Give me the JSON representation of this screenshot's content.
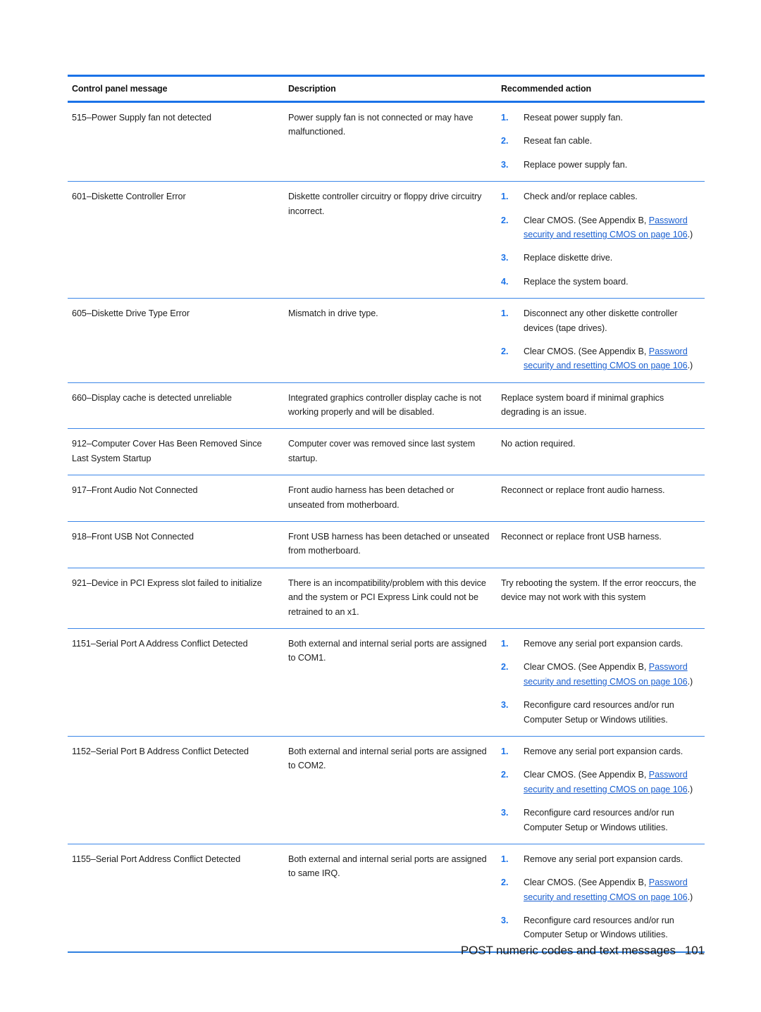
{
  "colors": {
    "rule_blue": "#1a72e8",
    "row_rule_blue": "#3b86e8",
    "link_blue": "#1a5fd0",
    "text": "#1c1c1c"
  },
  "table": {
    "headers": {
      "col1": "Control panel message",
      "col2": "Description",
      "col3": "Recommended action"
    },
    "rows": [
      {
        "message": "515–Power Supply fan not detected",
        "description": "Power supply fan is not connected or may have malfunctioned.",
        "action_type": "steps",
        "steps": [
          {
            "num": "1.",
            "text": "Reseat power supply fan."
          },
          {
            "num": "2.",
            "text": "Reseat fan cable."
          },
          {
            "num": "3.",
            "text": "Replace power supply fan."
          }
        ]
      },
      {
        "message": "601–Diskette Controller Error",
        "description": "Diskette controller circuitry or floppy drive circuitry incorrect.",
        "action_type": "steps",
        "steps": [
          {
            "num": "1.",
            "text": "Check and/or replace cables."
          },
          {
            "num": "2.",
            "text": "Clear CMOS. (See Appendix B, ",
            "link": "Password security and resetting CMOS on page 106",
            "tail": ".)"
          },
          {
            "num": "3.",
            "text": "Replace diskette drive."
          },
          {
            "num": "4.",
            "text": "Replace the system board."
          }
        ]
      },
      {
        "message": "605–Diskette Drive Type Error",
        "description": "Mismatch in drive type.",
        "action_type": "steps",
        "steps": [
          {
            "num": "1.",
            "text": "Disconnect any other diskette controller devices (tape drives)."
          },
          {
            "num": "2.",
            "text": "Clear CMOS. (See Appendix B, ",
            "link": "Password security and resetting CMOS on page 106",
            "tail": ".)"
          }
        ]
      },
      {
        "message": "660–Display cache is detected unreliable",
        "description": "Integrated graphics controller display cache is not working properly and will be disabled.",
        "action_type": "plain",
        "action": "Replace system board if minimal graphics degrading is an issue."
      },
      {
        "message": "912–Computer Cover Has Been Removed Since Last System Startup",
        "description": "Computer cover was removed since last system startup.",
        "action_type": "plain",
        "action": "No action required."
      },
      {
        "message": "917–Front Audio Not Connected",
        "description": "Front audio harness has been detached or unseated from motherboard.",
        "action_type": "plain",
        "action": "Reconnect or replace front audio harness."
      },
      {
        "message": "918–Front USB Not Connected",
        "description": "Front USB harness has been detached or unseated from motherboard.",
        "action_type": "plain",
        "action": "Reconnect or replace front USB harness."
      },
      {
        "message": "921–Device in PCI Express slot failed to initialize",
        "description": "There is an incompatibility/problem with this device and the system or PCI Express Link could not be retrained to an x1.",
        "action_type": "plain",
        "action": "Try rebooting the system. If the error reoccurs, the device may not work with this system"
      },
      {
        "message": "1151–Serial Port A Address Conflict Detected",
        "description": "Both external and internal serial ports are assigned to COM1.",
        "action_type": "steps",
        "steps": [
          {
            "num": "1.",
            "text": "Remove any serial port expansion cards."
          },
          {
            "num": "2.",
            "text": "Clear CMOS. (See Appendix B, ",
            "link": "Password security and resetting CMOS on page 106",
            "tail": ".)"
          },
          {
            "num": "3.",
            "text": "Reconfigure card resources and/or run Computer Setup or Windows utilities."
          }
        ]
      },
      {
        "message": "1152–Serial Port B Address Conflict Detected",
        "description": "Both external and internal serial ports are assigned to COM2.",
        "action_type": "steps",
        "steps": [
          {
            "num": "1.",
            "text": "Remove any serial port expansion cards."
          },
          {
            "num": "2.",
            "text": "Clear CMOS. (See Appendix B, ",
            "link": "Password security and resetting CMOS on page 106",
            "tail": ".)"
          },
          {
            "num": "3.",
            "text": "Reconfigure card resources and/or run Computer Setup or Windows utilities."
          }
        ]
      },
      {
        "message": "1155–Serial Port Address Conflict Detected",
        "description": "Both external and internal serial ports are assigned to same IRQ.",
        "action_type": "steps",
        "steps": [
          {
            "num": "1.",
            "text": "Remove any serial port expansion cards."
          },
          {
            "num": "2.",
            "text": "Clear CMOS. (See Appendix B, ",
            "link": "Password security and resetting CMOS on page 106",
            "tail": ".)"
          },
          {
            "num": "3.",
            "text": "Reconfigure card resources and/or run Computer Setup or Windows utilities."
          }
        ]
      }
    ]
  },
  "footer": {
    "title": "POST numeric codes and text messages",
    "page_number": "101"
  }
}
